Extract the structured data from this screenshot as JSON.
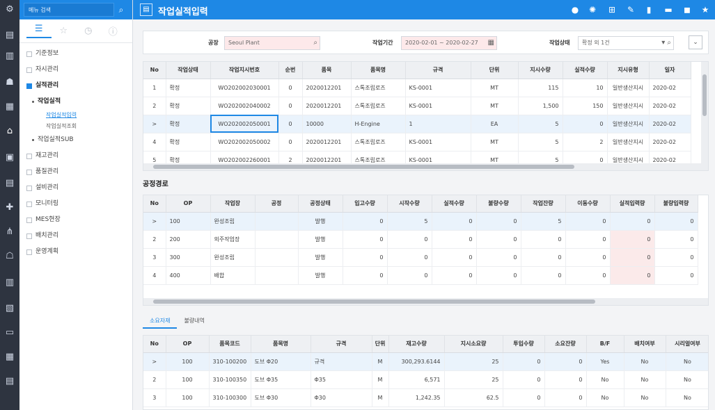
{
  "app": {
    "title": "작업실적입력",
    "search_placeholder": "메뉴 검색"
  },
  "colors": {
    "accent": "#1e88e5",
    "rail": "#2e3440",
    "selected_row": "#eaf3fc",
    "required_field": "#fde9ea"
  },
  "sidebar": {
    "items": [
      {
        "label": "기준정보"
      },
      {
        "label": "자시관리"
      },
      {
        "label": "실적관리",
        "selected": true
      },
      {
        "label": "작업실적",
        "level": "sub"
      },
      {
        "label": "작업실적입력",
        "level": "sub2",
        "current": true
      },
      {
        "label": "작업실적조회",
        "level": "sub2"
      },
      {
        "label": "작업실적SUB",
        "level": "subn"
      },
      {
        "label": "재고관리"
      },
      {
        "label": "품질관리"
      },
      {
        "label": "설비관리"
      },
      {
        "label": "모니터링"
      },
      {
        "label": "MES현장"
      },
      {
        "label": "배치관리"
      },
      {
        "label": "운영계획"
      }
    ]
  },
  "filter": {
    "plant_label": "공장",
    "plant_value": "Seoul Plant",
    "period_label": "작업기간",
    "period_value": "2020-02-01 ~ 2020-02-27",
    "status_label": "작업상태",
    "status_value": "확정 외 1건"
  },
  "work_grid": {
    "headers": [
      "No",
      "작업상태",
      "작업지시번호",
      "순번",
      "품목",
      "품목명",
      "규격",
      "단위",
      "지시수량",
      "실적수량",
      "지시유형",
      "일자"
    ],
    "rows": [
      [
        "1",
        "확정",
        "WO202002030001",
        "0",
        "2020012201",
        "스톡조립로즈",
        "KS-0001",
        "MT",
        "115",
        "10",
        "일반생산지시",
        "2020-02"
      ],
      [
        "2",
        "확정",
        "WO202002040002",
        "0",
        "2020012201",
        "스톡조립로즈",
        "KS-0001",
        "MT",
        "1,500",
        "150",
        "일반생산지시",
        "2020-02"
      ],
      [
        ">",
        "확정",
        "WO202002050001",
        "0",
        "10000",
        "H-Engine",
        "1",
        "EA",
        "5",
        "0",
        "일반생산지시",
        "2020-02"
      ],
      [
        "4",
        "확정",
        "WO202002050002",
        "0",
        "2020012201",
        "스톡조립로즈",
        "KS-0001",
        "MT",
        "5",
        "2",
        "일반생산지시",
        "2020-02"
      ],
      [
        "5",
        "확정",
        "WO202002260001",
        "2",
        "2020012201",
        "스톡조립로즈",
        "KS-0001",
        "MT",
        "5",
        "0",
        "일반생산지시",
        "2020-02"
      ]
    ]
  },
  "routing": {
    "title": "공정경로",
    "headers": [
      "No",
      "OP",
      "작업장",
      "공정",
      "공정상태",
      "입고수량",
      "시작수량",
      "실적수량",
      "불량수량",
      "작업잔량",
      "이동수량",
      "실적입력량",
      "불량입력량"
    ],
    "rows": [
      [
        ">",
        "100",
        "완성조립",
        "",
        "발행",
        "0",
        "5",
        "0",
        "0",
        "5",
        "0",
        "0",
        "0"
      ],
      [
        "2",
        "200",
        "외주작업장",
        "",
        "발행",
        "0",
        "0",
        "0",
        "0",
        "0",
        "0",
        "0",
        "0"
      ],
      [
        "3",
        "300",
        "완성조립",
        "",
        "발행",
        "0",
        "0",
        "0",
        "0",
        "0",
        "0",
        "0",
        "0"
      ],
      [
        "4",
        "400",
        "배합",
        "",
        "발행",
        "0",
        "0",
        "0",
        "0",
        "0",
        "0",
        "0",
        "0"
      ]
    ]
  },
  "tabs": [
    "소요자재",
    "불량내역"
  ],
  "materials": {
    "headers": [
      "No",
      "OP",
      "품목코드",
      "품목명",
      "규격",
      "단위",
      "재고수량",
      "지시소요량",
      "투입수량",
      "소요잔량",
      "B/F",
      "배치여부",
      "시리얼여부"
    ],
    "rows": [
      [
        ">",
        "100",
        "310-100200",
        "도브 Φ20",
        "규격",
        "M",
        "300,293.6144",
        "25",
        "0",
        "0",
        "Yes",
        "No",
        "No"
      ],
      [
        "2",
        "100",
        "310-100350",
        "도브 Φ35",
        "Φ35",
        "M",
        "6,571",
        "25",
        "0",
        "0",
        "No",
        "No",
        "No"
      ],
      [
        "3",
        "100",
        "310-100300",
        "도브 Φ30",
        "Φ30",
        "M",
        "1,242.35",
        "62.5",
        "0",
        "0",
        "No",
        "No",
        "No"
      ]
    ]
  }
}
